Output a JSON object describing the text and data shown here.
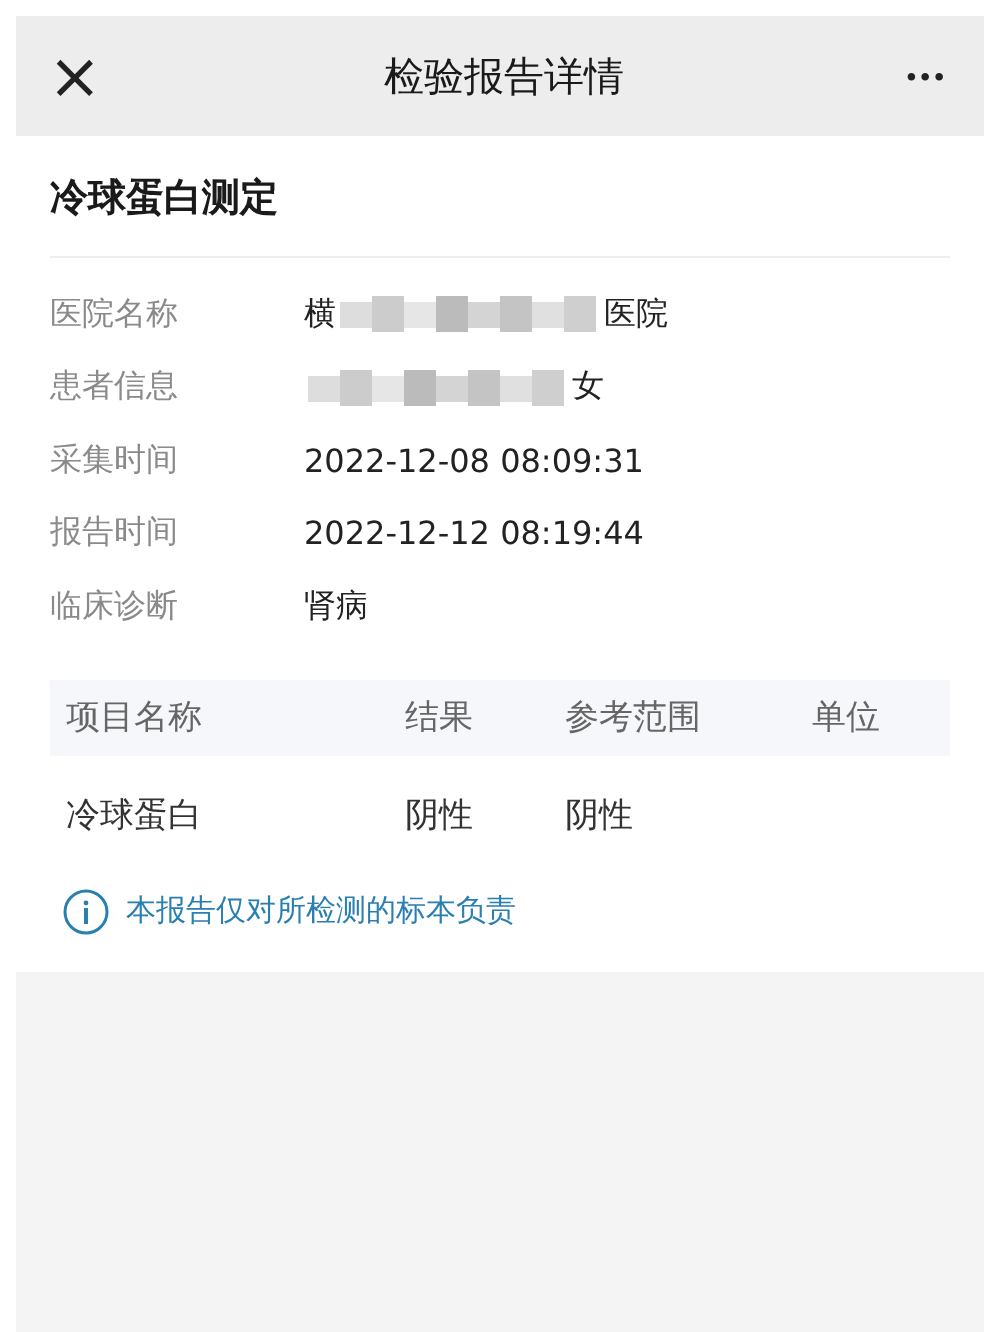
{
  "header": {
    "close_glyph": "×",
    "title": "检验报告详情",
    "more_glyph": "•••"
  },
  "report": {
    "title": "冷球蛋白测定",
    "fields": [
      {
        "label": "医院名称",
        "prefix": "横",
        "value": "医院",
        "redacted": true
      },
      {
        "label": "患者信息",
        "value": "女",
        "redacted": true
      },
      {
        "label": "采集时间",
        "value": "2022-12-08 08:09:31",
        "redacted": false
      },
      {
        "label": "报告时间",
        "value": "2022-12-12 08:19:44",
        "redacted": false
      },
      {
        "label": "临床诊断",
        "value": "肾病",
        "redacted": false
      }
    ]
  },
  "table": {
    "columns": [
      "项目名称",
      "结果",
      "参考范围",
      "单位"
    ],
    "rows": [
      [
        "冷球蛋白",
        "阴性",
        "阴性",
        ""
      ]
    ]
  },
  "note": "本报告仅对所检测的标本负责"
}
